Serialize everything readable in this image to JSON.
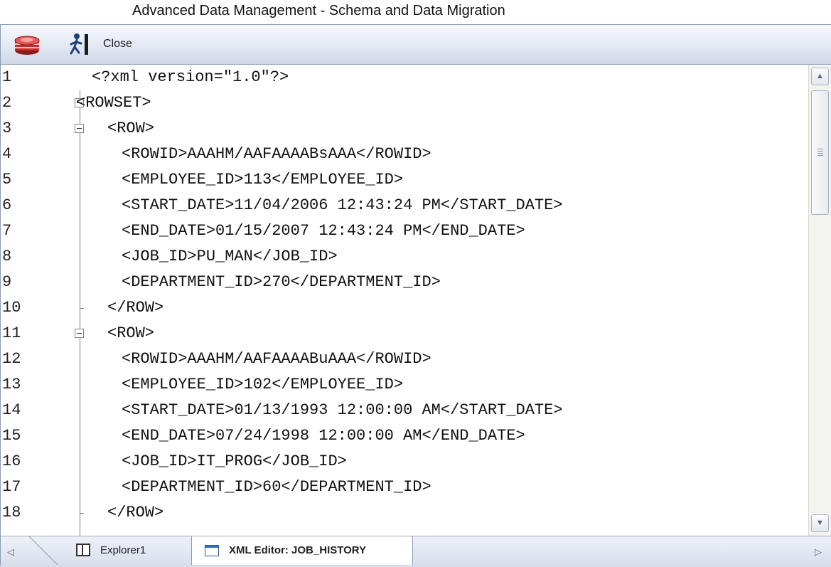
{
  "document": {
    "title": "Advanced Data Management - Schema and Data Migration"
  },
  "toolbar": {
    "execute_icon": "database-execute-icon",
    "run_icon": "exit-run-icon",
    "close_label": "Close"
  },
  "editor": {
    "line_numbers": [
      "1",
      "2",
      "3",
      "4",
      "5",
      "6",
      "7",
      "8",
      "9",
      "10",
      "11",
      "12",
      "13",
      "14",
      "15",
      "16",
      "17",
      "18"
    ],
    "lines": [
      "<?xml version=\"1.0\"?>",
      "<ROWSET>",
      " <ROW>",
      "  <ROWID>AAAHM/AAFAAAABsAAA</ROWID>",
      "  <EMPLOYEE_ID>113</EMPLOYEE_ID>",
      "  <START_DATE>11/04/2006 12:43:24 PM</START_DATE>",
      "  <END_DATE>01/15/2007 12:43:24 PM</END_DATE>",
      "  <JOB_ID>PU_MAN</JOB_ID>",
      "  <DEPARTMENT_ID>270</DEPARTMENT_ID>",
      " </ROW>",
      " <ROW>",
      "  <ROWID>AAAHM/AAFAAAABuAAA</ROWID>",
      "  <EMPLOYEE_ID>102</EMPLOYEE_ID>",
      "  <START_DATE>01/13/1993 12:00:00 AM</START_DATE>",
      "  <END_DATE>07/24/1998 12:00:00 AM</END_DATE>",
      "  <JOB_ID>IT_PROG</JOB_ID>",
      "  <DEPARTMENT_ID>60</DEPARTMENT_ID>",
      " </ROW>"
    ]
  },
  "tabs": [
    {
      "label": "Explorer1",
      "icon": "panel-icon",
      "active": false
    },
    {
      "label": "XML Editor: JOB_HISTORY",
      "icon": "window-icon",
      "active": true
    }
  ],
  "colors": {
    "toolbar_bg": "#e3e8f3",
    "editor_bg": "#ffffff",
    "text": "#111111"
  }
}
